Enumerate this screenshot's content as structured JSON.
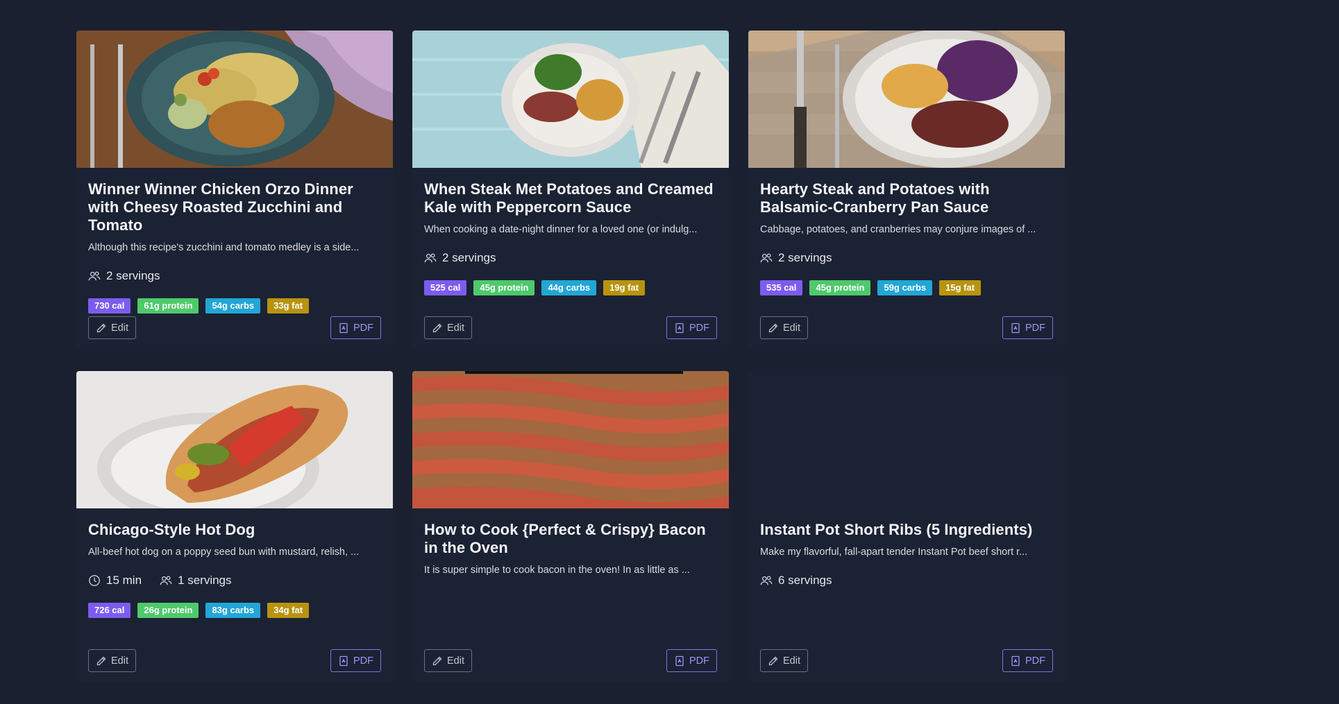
{
  "recipes": [
    {
      "title": "Winner Winner Chicken Orzo Dinner with Cheesy Roasted Zucchini and Tomato",
      "description": "Although this recipe's zucchini and tomato medley is a side...",
      "time": null,
      "servings": "2 servings",
      "nutrition": {
        "cal": "730 cal",
        "protein": "61g protein",
        "carbs": "54g carbs",
        "fat": "33g fat"
      },
      "image": "chicken-orzo-plate",
      "edit_label": "Edit",
      "pdf_label": "PDF"
    },
    {
      "title": "When Steak Met Potatoes and Creamed Kale with Peppercorn Sauce",
      "description": "When cooking a date-night dinner for a loved one (or indulg...",
      "time": null,
      "servings": "2 servings",
      "nutrition": {
        "cal": "525 cal",
        "protein": "45g protein",
        "carbs": "44g carbs",
        "fat": "19g fat"
      },
      "image": "steak-potatoes-kale-plate",
      "edit_label": "Edit",
      "pdf_label": "PDF"
    },
    {
      "title": "Hearty Steak and Potatoes with Balsamic-Cranberry Pan Sauce",
      "description": "Cabbage, potatoes, and cranberries may conjure images of ...",
      "time": null,
      "servings": "2 servings",
      "nutrition": {
        "cal": "535 cal",
        "protein": "45g protein",
        "carbs": "59g carbs",
        "fat": "15g fat"
      },
      "image": "steak-cabbage-plate",
      "edit_label": "Edit",
      "pdf_label": "PDF"
    },
    {
      "title": "Chicago-Style Hot Dog",
      "description": "All-beef hot dog on a poppy seed bun with mustard, relish, ...",
      "time": "15 min",
      "servings": "1 servings",
      "nutrition": {
        "cal": "726 cal",
        "protein": "26g protein",
        "carbs": "83g carbs",
        "fat": "34g fat"
      },
      "image": "hot-dog",
      "edit_label": "Edit",
      "pdf_label": "PDF"
    },
    {
      "title": "How to Cook {Perfect & Crispy} Bacon in the Oven",
      "description": "It is super simple to cook bacon in the oven!  In as little as ...",
      "time": null,
      "servings": null,
      "nutrition": null,
      "image": "bacon-tray",
      "edit_label": "Edit",
      "pdf_label": "PDF"
    },
    {
      "title": "Instant Pot Short Ribs (5 Ingredients)",
      "description": "Make my flavorful, fall-apart tender Instant Pot beef short r...",
      "time": null,
      "servings": "6 servings",
      "nutrition": null,
      "image": null,
      "edit_label": "Edit",
      "pdf_label": "PDF"
    }
  ],
  "colors": {
    "background": "#1a2030",
    "card": "#1b2233",
    "cal": "#7c5cf0",
    "protein": "#4fc96b",
    "carbs": "#22a6d6",
    "fat": "#b8930e",
    "pdf_accent": "#9c94ff"
  }
}
